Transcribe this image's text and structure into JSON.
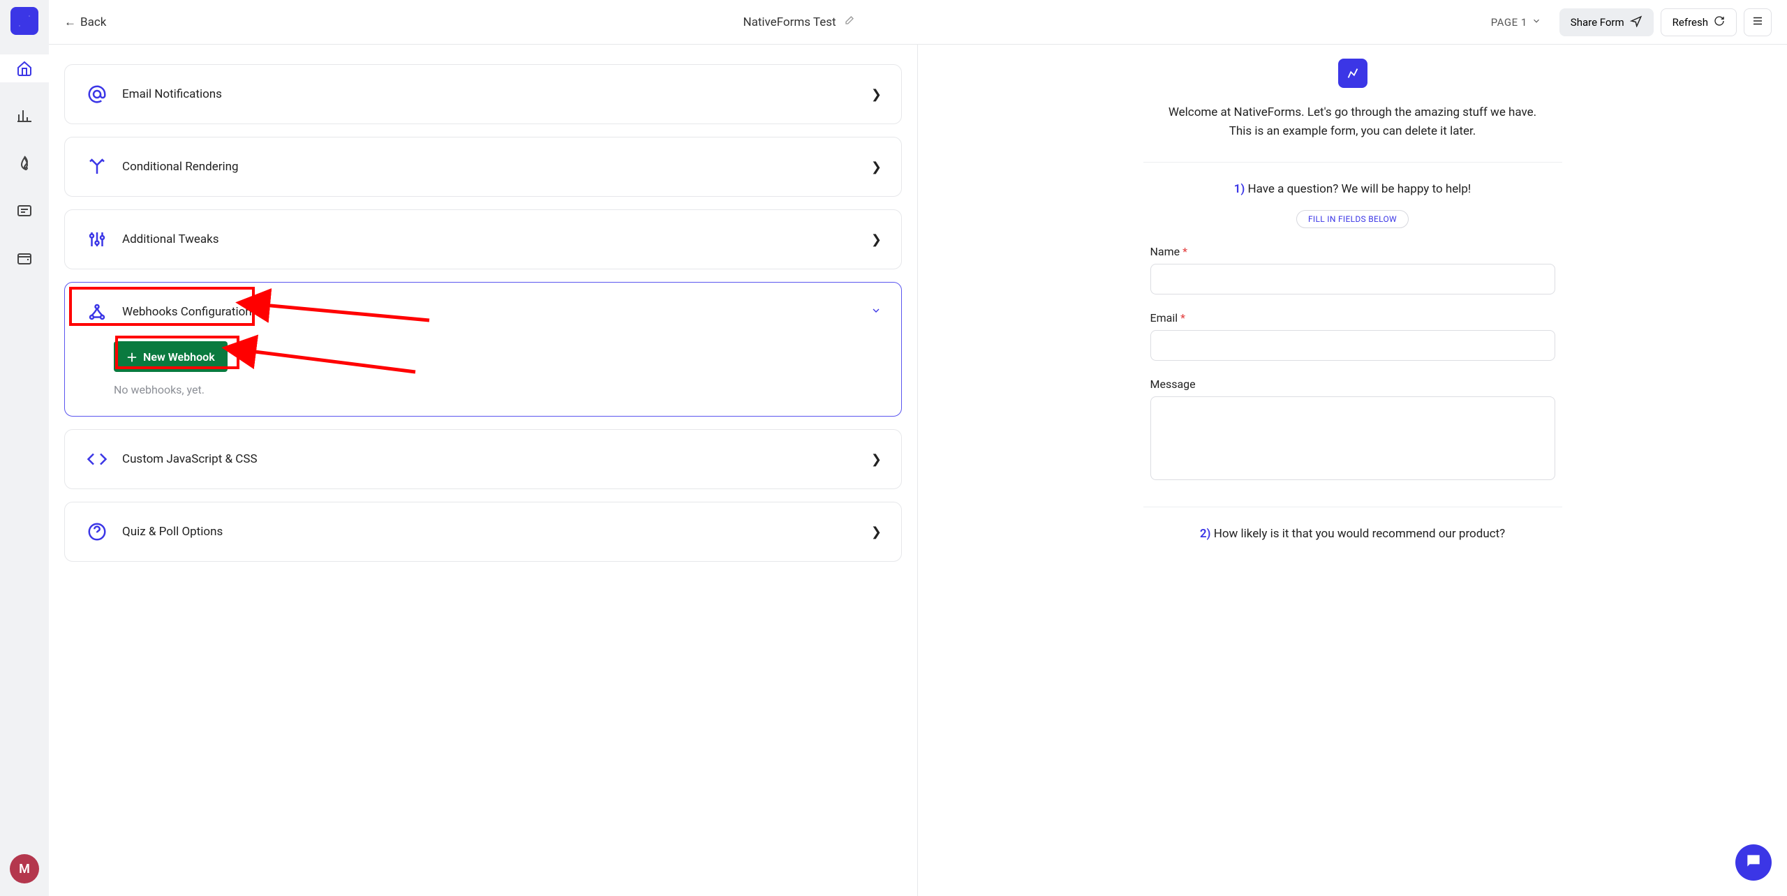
{
  "rail": {
    "avatar_letter": "M"
  },
  "topbar": {
    "back_label": "Back",
    "title": "NativeForms Test",
    "page_selector": "PAGE 1",
    "share_label": "Share Form",
    "refresh_label": "Refresh"
  },
  "settings": {
    "items": [
      {
        "icon": "at",
        "label": "Email Notifications"
      },
      {
        "icon": "branch",
        "label": "Conditional Rendering"
      },
      {
        "icon": "sliders",
        "label": "Additional Tweaks"
      },
      {
        "icon": "webhook",
        "label": "Webhooks Configuration",
        "active": true
      },
      {
        "icon": "code",
        "label": "Custom JavaScript & CSS"
      },
      {
        "icon": "question",
        "label": "Quiz & Poll Options"
      }
    ],
    "webhook_panel": {
      "new_button": "New Webhook",
      "empty": "No webhooks, yet."
    }
  },
  "preview": {
    "welcome": "Welcome at NativeForms. Let's go through the amazing stuff we have. This is an example form, you can delete it later.",
    "q1_num": "1)",
    "q1_text": "Have a question? We will be happy to help!",
    "hint": "FILL IN FIELDS BELOW",
    "fields": {
      "name_label": "Name",
      "email_label": "Email",
      "message_label": "Message"
    },
    "q2_num": "2)",
    "q2_text": "How likely is it that you would recommend our product?"
  }
}
